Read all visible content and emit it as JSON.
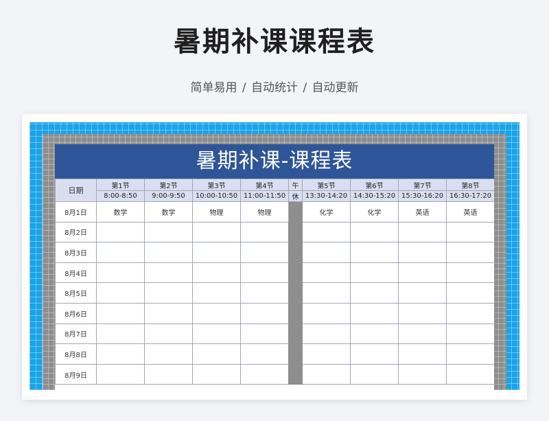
{
  "page": {
    "title": "暑期补课课程表",
    "subtitle": "简单易用  /  自动统计  /  自动更新"
  },
  "sheet": {
    "title": "暑期补课-课程表",
    "date_header": "日期",
    "lunch_top": "午",
    "lunch_bottom": "休",
    "periods": [
      {
        "name": "第1节",
        "time": "8:00-8:50"
      },
      {
        "name": "第2节",
        "time": "9:00-9:50"
      },
      {
        "name": "第3节",
        "time": "10:00-10:50"
      },
      {
        "name": "第4节",
        "time": "11:00-11:50"
      },
      {
        "name": "第5节",
        "time": "13:30-14:20"
      },
      {
        "name": "第6节",
        "time": "14:30-15:20"
      },
      {
        "name": "第7节",
        "time": "15:30-16:20"
      },
      {
        "name": "第8节",
        "time": "16:30-17:20"
      }
    ],
    "rows": [
      {
        "date": "8月1日",
        "cells": [
          "数学",
          "数学",
          "物理",
          "物理",
          "化学",
          "化学",
          "英语",
          "英语"
        ]
      },
      {
        "date": "8月2日",
        "cells": [
          "",
          "",
          "",
          "",
          "",
          "",
          "",
          ""
        ]
      },
      {
        "date": "8月3日",
        "cells": [
          "",
          "",
          "",
          "",
          "",
          "",
          "",
          ""
        ]
      },
      {
        "date": "8月4日",
        "cells": [
          "",
          "",
          "",
          "",
          "",
          "",
          "",
          ""
        ]
      },
      {
        "date": "8月5日",
        "cells": [
          "",
          "",
          "",
          "",
          "",
          "",
          "",
          ""
        ]
      },
      {
        "date": "8月6日",
        "cells": [
          "",
          "",
          "",
          "",
          "",
          "",
          "",
          ""
        ]
      },
      {
        "date": "8月7日",
        "cells": [
          "",
          "",
          "",
          "",
          "",
          "",
          "",
          ""
        ]
      },
      {
        "date": "8月8日",
        "cells": [
          "",
          "",
          "",
          "",
          "",
          "",
          "",
          ""
        ]
      },
      {
        "date": "8月9日",
        "cells": [
          "",
          "",
          "",
          "",
          "",
          "",
          "",
          ""
        ]
      }
    ]
  },
  "colors": {
    "title_bar": "#2e5597",
    "header_fill": "#d9dff0",
    "outer_frame": "#1aa3e8",
    "inner_frame": "#8e8e8e",
    "page_background": "#f2f4f7"
  }
}
